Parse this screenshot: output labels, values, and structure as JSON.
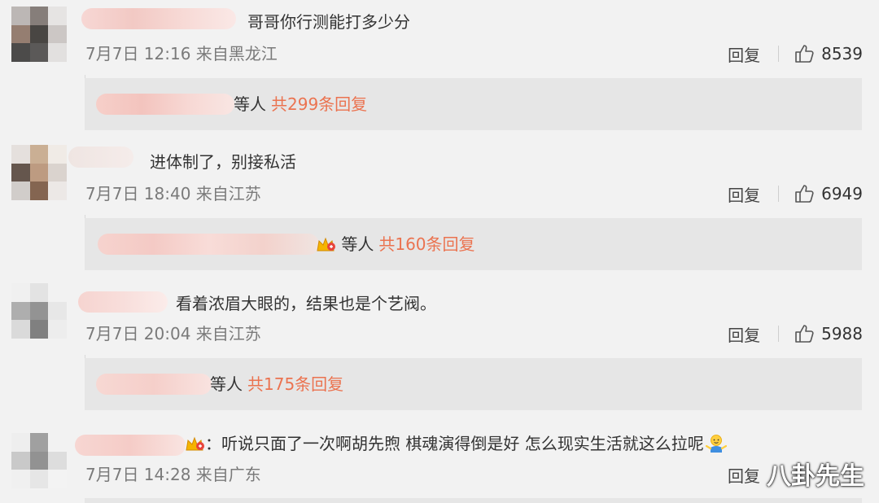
{
  "comments": [
    {
      "text": "哥哥你行测能打多少分",
      "meta": "7月7日 12:16 来自黑龙江",
      "reply_label": "回复",
      "likes": "8539",
      "replies": {
        "etc": "等人",
        "count_label": "共299条回复"
      }
    },
    {
      "text": "进体制了，别接私活",
      "meta": "7月7日 18:40 来自江苏",
      "reply_label": "回复",
      "likes": "6949",
      "replies": {
        "etc": "等人",
        "count_label": "共160条回复"
      }
    },
    {
      "text": "看着浓眉大眼的，结果也是个艺阀。",
      "meta": "7月7日 20:04 来自江苏",
      "reply_label": "回复",
      "likes": "5988",
      "replies": {
        "etc": "等人",
        "count_label": "共175条回复"
      }
    },
    {
      "prefix": "：",
      "text": "听说只面了一次啊胡先煦 棋魂演得倒是好 怎么现实生活就这么拉呢",
      "meta": "7月7日 14:28 来自广东",
      "reply_label": "回复"
    }
  ],
  "watermark": "八卦先生",
  "colors": {
    "accent": "#eb7350",
    "reply_box": "#e6e6e6",
    "background": "#f2f2f2"
  },
  "icons": {
    "like": "thumbs-up-icon",
    "crown": "crown-badge-icon",
    "shrug": "shrug-emoji-icon"
  }
}
